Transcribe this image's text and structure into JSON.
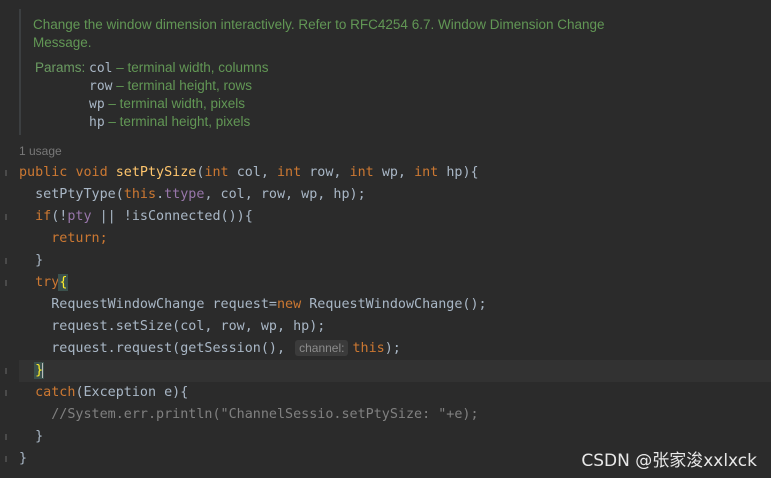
{
  "doc_comment": {
    "description": "Change the window dimension interactively. Refer to RFC4254 6.7. Window Dimension Change Message.",
    "params_label": "Params:",
    "params": [
      {
        "name": "col",
        "desc": "– terminal width, columns"
      },
      {
        "name": "row",
        "desc": "– terminal height, rows"
      },
      {
        "name": "wp",
        "desc": "– terminal width, pixels"
      },
      {
        "name": "hp",
        "desc": "– terminal height, pixels"
      }
    ]
  },
  "usage_hint": "1 usage",
  "code": {
    "kw_public": "public",
    "kw_void": "void",
    "method_name": "setPtySize",
    "param_type": "int",
    "line1_args": [
      "col, ",
      "row, ",
      "wp, ",
      "hp"
    ],
    "set_pty_type_call": "setPtyType(",
    "this_kw": "this",
    "ttype_field": "ttype",
    "set_pty_type_args": ", col, row, wp, hp);",
    "if_kw": "if",
    "pty_field": "pty",
    "if_condition_rest": " || !isConnected()){",
    "return_kw": "return",
    "close_brace": "}",
    "try_kw": "try",
    "request_type": "RequestWindowChange request=",
    "new_kw": "new",
    "request_ctor": " RequestWindowChange();",
    "set_size_call": "request.setSize(col, row, wp, hp);",
    "request_call": "request.request(getSession(), ",
    "inlay_hint": "channel:",
    "request_call_end": ");",
    "catch_kw": "catch",
    "catch_args": "(Exception e){",
    "comment_line": "//System.err.println(\"ChannelSessio.setPtySize: \"+e);"
  },
  "watermark": "CSDN @张家浚xxlxck",
  "colors": {
    "background": "#2b2b2b",
    "keyword": "#cc7832",
    "method": "#ffc66d",
    "field": "#9876aa",
    "comment": "#808080",
    "doc_text": "#629755"
  }
}
